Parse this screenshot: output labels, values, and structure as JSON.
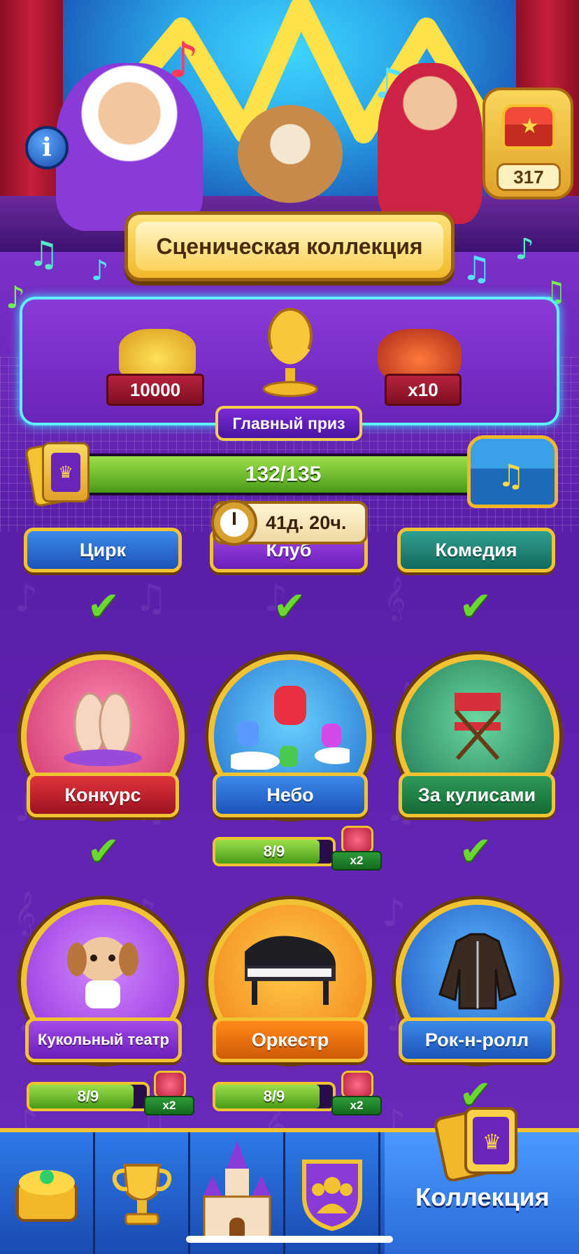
{
  "header": {
    "title": "Сценическая коллекция",
    "info_icon": "info-icon",
    "chest_count": "317"
  },
  "main_prize": {
    "label": "Главный приз",
    "rewards": [
      {
        "icon": "coins-icon",
        "value": "10000"
      },
      {
        "icon": "golden-microphone-icon",
        "value": ""
      },
      {
        "icon": "tnt-bundle-icon",
        "value": "x10"
      }
    ]
  },
  "collection_progress": {
    "text": "132/135",
    "current": 132,
    "total": 135
  },
  "timer": {
    "text": "41д. 20ч."
  },
  "sets_row0": [
    {
      "label": "Цирк",
      "color": "blue",
      "completed": true
    },
    {
      "label": "Клуб",
      "color": "purple",
      "completed": true
    },
    {
      "label": "Комедия",
      "color": "teal",
      "completed": true
    }
  ],
  "sets_row1": [
    {
      "label": "Конкурс",
      "color": "red",
      "completed": true
    },
    {
      "label": "Небо",
      "color": "blue",
      "completed": false,
      "progress_text": "8/9",
      "progress": 0.889,
      "reward": "x2"
    },
    {
      "label": "За кулисами",
      "color": "green",
      "completed": true
    }
  ],
  "sets_row2": [
    {
      "label": "Кукольный театр",
      "color": "purple",
      "completed": false,
      "progress_text": "8/9",
      "progress": 0.889,
      "reward": "x2"
    },
    {
      "label": "Оркестр",
      "color": "orange",
      "completed": false,
      "progress_text": "8/9",
      "progress": 0.889,
      "reward": "x2"
    },
    {
      "label": "Рок-н-ролл",
      "color": "blue",
      "completed": true
    }
  ],
  "bottom_nav": {
    "items": [
      "shop-chest-icon",
      "trophy-icon",
      "castle-icon",
      "team-icon",
      "collection-cards-icon"
    ],
    "active_label": "Коллекция"
  },
  "colors": {
    "accent_gold": "#f1c332",
    "background_purple": "#5a1ea8",
    "progress_green": "#6ad830"
  }
}
